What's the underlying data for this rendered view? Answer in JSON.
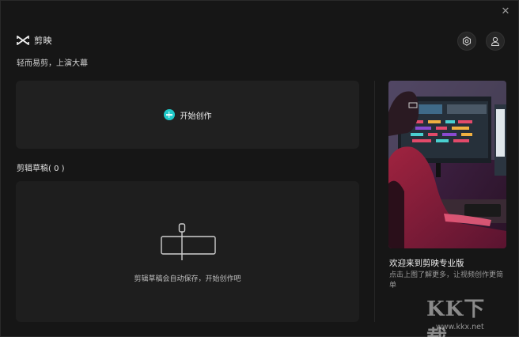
{
  "window": {
    "close_label": "✕"
  },
  "header": {
    "app_name": "剪映",
    "slogan": "轻而易剪，上演大幕"
  },
  "create": {
    "label": "开始创作"
  },
  "drafts": {
    "title": "剪辑草稿( 0 )",
    "empty_hint": "剪辑草稿会自动保存，开始创作吧"
  },
  "promo": {
    "title": "欢迎来到剪映专业版",
    "description": "点击上图了解更多，让视频创作更简单"
  },
  "watermark": {
    "logo": "KK下载",
    "url": "www.kkx.net"
  },
  "colors": {
    "accent": "#1fc9c9",
    "background": "#161616",
    "panel": "#202020"
  },
  "icons": [
    "capcut-logo-icon",
    "settings-icon",
    "user-icon",
    "plus-icon",
    "draft-placeholder-icon"
  ]
}
